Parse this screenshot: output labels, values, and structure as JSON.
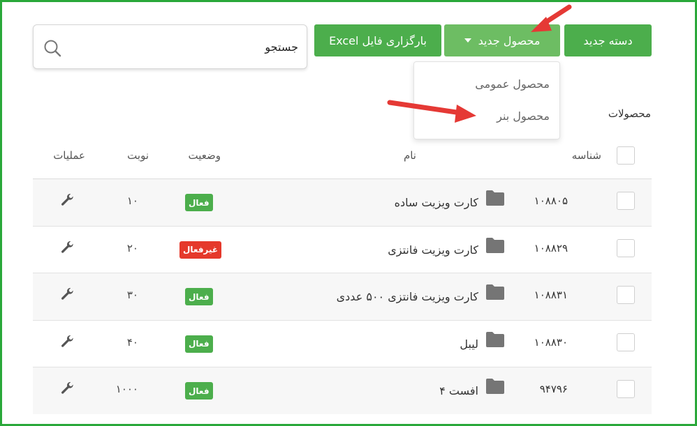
{
  "toolbar": {
    "new_category_label": "دسته جدید",
    "new_product_label": "محصول جدید",
    "upload_excel_label": "بارگزاری فایل Excel"
  },
  "search": {
    "value": "جستجو"
  },
  "dropdown": {
    "items": [
      "محصول عمومی",
      "محصول بنر"
    ]
  },
  "section_title": "محصولات",
  "table": {
    "headers": {
      "id": "شناسه",
      "name": "نام",
      "status": "وضعیت",
      "order": "نوبت",
      "operations": "عملیات"
    },
    "rows": [
      {
        "id": "۱۰۸۸۰۵",
        "name": "کارت ویزیت ساده",
        "status": "فعال",
        "order": "۱۰"
      },
      {
        "id": "۱۰۸۸۲۹",
        "name": "کارت ویزیت فانتزی",
        "status": "غیرفعال",
        "order": "۲۰"
      },
      {
        "id": "۱۰۸۸۳۱",
        "name": "کارت ویزیت فانتزی ۵۰۰ عددی",
        "status": "فعال",
        "order": "۳۰"
      },
      {
        "id": "۱۰۸۸۳۰",
        "name": "لیبل",
        "status": "فعال",
        "order": "۴۰"
      },
      {
        "id": "۹۴۷۹۶",
        "name": "افست ۴",
        "status": "فعال",
        "order": "۱۰۰۰"
      }
    ]
  },
  "icons": {
    "search": "search-icon",
    "folder": "folder-icon",
    "operations": "wrench-icon",
    "dropdown": "caret-down-icon"
  },
  "colors": {
    "primary": "#4cae4c",
    "active": "#4cae4c",
    "inactive": "#e5392b",
    "annotation_arrow": "#e53935",
    "frame": "#2aa83a"
  }
}
